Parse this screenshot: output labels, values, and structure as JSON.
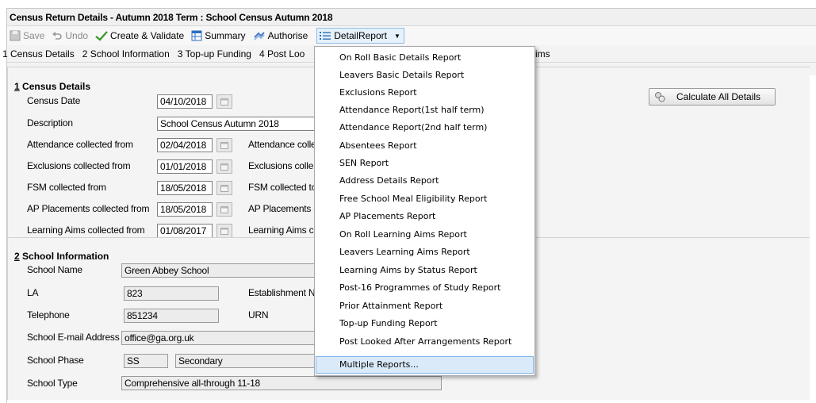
{
  "window": {
    "title": "Census Return Details - Autumn 2018 Term : School Census Autumn 2018"
  },
  "toolbar": {
    "save": "Save",
    "undo": "Undo",
    "create_validate": "Create & Validate",
    "summary": "Summary",
    "authorise": "Authorise",
    "detail_report": "DetailReport"
  },
  "nav": {
    "links": [
      "1 Census Details",
      "2 School Information",
      "3 Top-up Funding",
      "4 Post Loo"
    ],
    "tail": "Aims"
  },
  "census": {
    "title_num": "1",
    "title_text": " Census Details",
    "census_date_label": "Census Date",
    "census_date": "04/10/2018",
    "description_label": "Description",
    "description": "School Census Autumn 2018",
    "attendance_label": "Attendance collected from",
    "attendance_from": "02/04/2018",
    "attendance_to_label": "Attendance colle",
    "exclusions_label": "Exclusions collected from",
    "exclusions_from": "01/01/2018",
    "exclusions_to_label": "Exclusions colle",
    "fsm_label": "FSM collected from",
    "fsm_from": "18/05/2018",
    "fsm_to_label": "FSM collected to",
    "ap_label": "AP Placements collected from",
    "ap_from": "18/05/2018",
    "ap_to_label": "AP Placements c",
    "learning_label": "Learning Aims collected from",
    "learning_from": "01/08/2017",
    "learning_to_label": "Learning Aims c",
    "calc_button": "Calculate All Details"
  },
  "school": {
    "title_num": "2",
    "title_text": " School Information",
    "name_label": "School Name",
    "name": "Green Abbey School",
    "la_label": "LA",
    "la": "823",
    "estab_label": "Establishment N",
    "telephone_label": "Telephone",
    "telephone": "851234",
    "urn_label": "URN",
    "email_label": "School E-mail Address",
    "email": "office@ga.org.uk",
    "phase_label": "School Phase",
    "phase_code": "SS",
    "phase": "Secondary",
    "type_label": "School Type",
    "type": "Comprehensive all-through 11-18"
  },
  "menu": {
    "items": [
      "On Roll Basic Details Report",
      "Leavers Basic Details Report",
      "Exclusions Report",
      "Attendance Report(1st half term)",
      "Attendance Report(2nd half term)",
      "Absentees Report",
      "SEN Report",
      "Address Details Report",
      "Free School Meal Eligibility Report",
      "AP Placements Report",
      "On Roll Learning Aims Report",
      "Leavers Learning Aims Report",
      "Learning Aims by Status Report",
      "Post-16 Programmes of Study Report",
      "Prior Attainment Report",
      "Top-up Funding Report",
      "Post Looked After Arrangements Report",
      "Multiple Reports..."
    ],
    "highlighted_index": 17
  },
  "colors": {
    "menu_highlight": "#dbeaf9",
    "menu_highlight_border": "#7eb4ea",
    "panel_bg": "#f4f4f4"
  }
}
